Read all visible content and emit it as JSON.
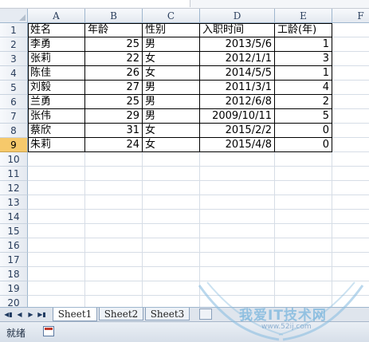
{
  "columns": [
    "A",
    "B",
    "C",
    "D",
    "E",
    "F"
  ],
  "row_numbers": [
    "1",
    "2",
    "3",
    "4",
    "5",
    "6",
    "7",
    "8",
    "9",
    "10",
    "11",
    "12",
    "13",
    "14",
    "15",
    "16",
    "17",
    "18",
    "19",
    "20"
  ],
  "active_row": "9",
  "table": {
    "headers": [
      "姓名",
      "年龄",
      "性别",
      "入职时间",
      "工龄(年)"
    ],
    "rows": [
      [
        "李勇",
        "25",
        "男",
        "2013/5/6",
        "1"
      ],
      [
        "张莉",
        "22",
        "女",
        "2012/1/1",
        "3"
      ],
      [
        "陈佳",
        "26",
        "女",
        "2014/5/5",
        "1"
      ],
      [
        "刘毅",
        "27",
        "男",
        "2011/3/1",
        "4"
      ],
      [
        "兰勇",
        "25",
        "男",
        "2012/6/8",
        "2"
      ],
      [
        "张伟",
        "29",
        "男",
        "2009/10/11",
        "5"
      ],
      [
        "蔡欣",
        "31",
        "女",
        "2015/2/2",
        "0"
      ],
      [
        "朱莉",
        "24",
        "女",
        "2015/4/8",
        "0"
      ]
    ]
  },
  "sheet_tabs": [
    "Sheet1",
    "Sheet2",
    "Sheet3"
  ],
  "active_sheet": "Sheet1",
  "status": {
    "ready": "就绪"
  },
  "watermark": {
    "text": "我爱IT技术网",
    "sub": "www.52ij.com"
  },
  "icons": {
    "nav_first": "first-sheet-icon",
    "nav_prev": "prev-sheet-icon",
    "nav_next": "next-sheet-icon",
    "nav_last": "last-sheet-icon",
    "insert_sheet": "insert-sheet-icon",
    "macro": "macro-record-icon"
  },
  "colors": {
    "active_row_header": "#f6c96b",
    "grid_line": "#d6dde6"
  }
}
